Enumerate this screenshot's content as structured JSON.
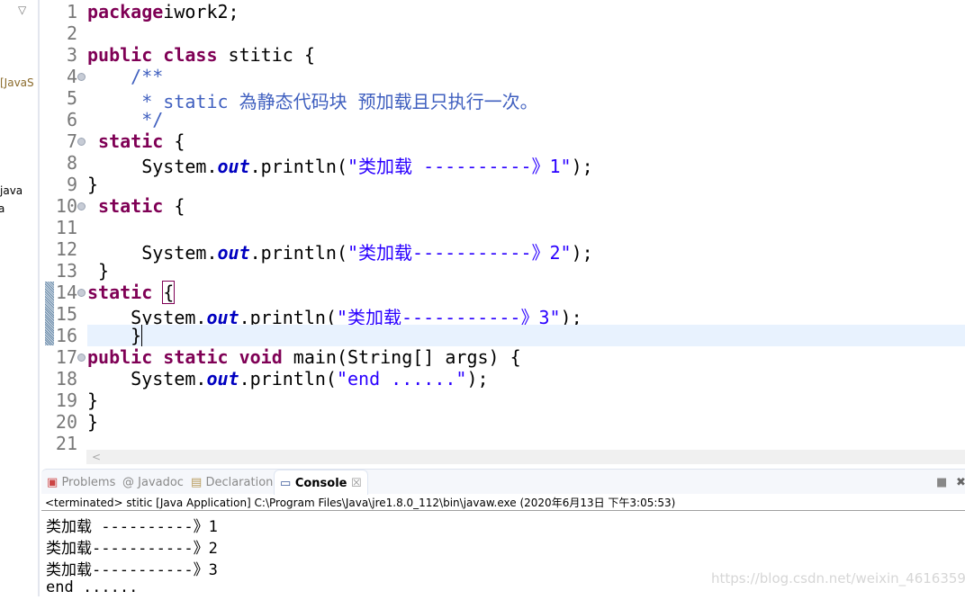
{
  "explorer": {
    "items": [
      "[JavaS",
      "java",
      "a"
    ]
  },
  "editor": {
    "current_line": 16,
    "lines": [
      [
        [
          "kw",
          "package"
        ],
        [
          "",
          "iwork2;"
        ]
      ],
      [],
      [
        [
          "kw",
          "public class"
        ],
        [
          "",
          " stitic {"
        ]
      ],
      [
        [
          "",
          ""
        ],
        [
          "cm",
          "    /**"
        ]
      ],
      [
        [
          "cm",
          "     * "
        ],
        [
          "cm",
          "static"
        ],
        [
          "cm",
          " 為静态代码块 预加载且只执行一次。"
        ]
      ],
      [
        [
          "cm",
          "     */"
        ]
      ],
      [
        [
          "",
          " "
        ],
        [
          "kw",
          "static"
        ],
        [
          "",
          " {"
        ]
      ],
      [
        [
          "",
          "     System."
        ],
        [
          "fld",
          "out"
        ],
        [
          "",
          ".println("
        ],
        [
          "str",
          "\"类加载 ----------》1\""
        ],
        [
          "",
          ");"
        ]
      ],
      [
        [
          "",
          "}"
        ]
      ],
      [
        [
          "",
          " "
        ],
        [
          "kw",
          "static"
        ],
        [
          "",
          " {"
        ]
      ],
      [],
      [
        [
          "",
          "     System."
        ],
        [
          "fld",
          "out"
        ],
        [
          "",
          ".println("
        ],
        [
          "str",
          "\"类加载-----------》2\""
        ],
        [
          "",
          ");"
        ]
      ],
      [
        [
          "",
          " }"
        ]
      ],
      [
        [
          "kw",
          "static"
        ],
        [
          "",
          " "
        ],
        [
          "bm",
          "{"
        ]
      ],
      [
        [
          "",
          "    System."
        ],
        [
          "fld",
          "out"
        ],
        [
          "",
          ".println("
        ],
        [
          "str",
          "\"类加载-----------》3\""
        ],
        [
          "",
          ");"
        ]
      ],
      [
        [
          "",
          "    }"
        ]
      ],
      [
        [
          "kw",
          "public static void"
        ],
        [
          "",
          " main(String[] args) {"
        ]
      ],
      [
        [
          "",
          "    System."
        ],
        [
          "fld",
          "out"
        ],
        [
          "",
          ".println("
        ],
        [
          "str",
          "\"end ......\""
        ],
        [
          "",
          ");"
        ]
      ],
      [
        [
          "",
          "}"
        ]
      ],
      [
        [
          "",
          "}"
        ]
      ],
      []
    ],
    "fold_lines": [
      4,
      7,
      10,
      14,
      17
    ],
    "scroll_left": "<"
  },
  "tabs": [
    {
      "label": "Problems",
      "icon": "problems-icon"
    },
    {
      "label": "Javadoc",
      "icon": "@"
    },
    {
      "label": "Declaration",
      "icon": "declaration-icon"
    },
    {
      "label": "Console",
      "icon": "console-icon",
      "active": true,
      "close": "☒"
    }
  ],
  "console": {
    "header": "<terminated> stitic [Java Application] C:\\Program Files\\Java\\jre1.8.0_112\\bin\\javaw.exe (2020年6月13日 下午3:05:53)",
    "output": [
      "类加载 ----------》1",
      "类加载-----------》2",
      "类加载-----------》3",
      "end ......"
    ]
  },
  "watermark": "https://blog.csdn.net/weixin_46163590"
}
